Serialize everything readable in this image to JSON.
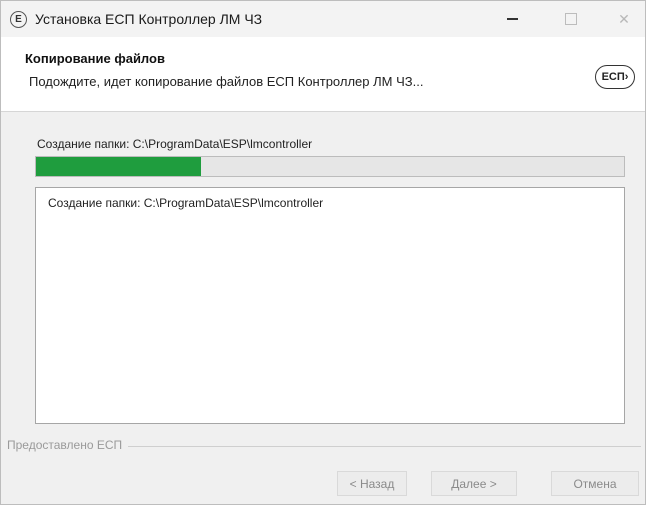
{
  "window": {
    "title": "Установка ЕСП Контроллер ЛМ ЧЗ",
    "icon_letter": "Е",
    "controls": [
      "minimize-icon",
      "maximize-icon",
      "close-icon"
    ]
  },
  "header": {
    "title": "Копирование файлов",
    "subtitle": "Подождите, идет копирование файлов ЕСП Контроллер ЛМ ЧЗ...",
    "logo_text": "ЕСП›"
  },
  "progress": {
    "status_text": "Создание папки: C:\\ProgramData\\ESP\\lmcontroller",
    "fraction": 0.28,
    "fill_color": "#1f9d3e"
  },
  "log": {
    "lines": [
      "Создание папки: C:\\ProgramData\\ESP\\lmcontroller"
    ]
  },
  "footer": {
    "branding": "Предоставлено ЕСП",
    "back_label": "< Назад",
    "next_label": "Далее >",
    "cancel_label": "Отмена"
  }
}
